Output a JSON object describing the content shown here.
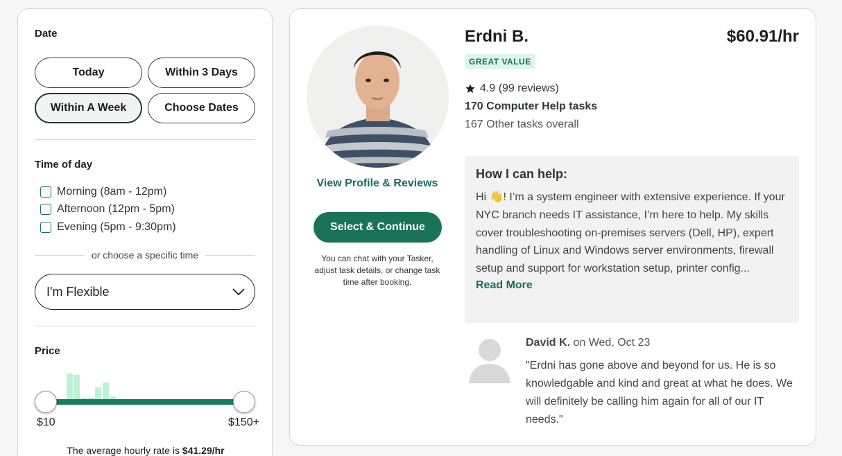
{
  "filters": {
    "date_title": "Date",
    "date_options": [
      "Today",
      "Within 3 Days",
      "Within A Week",
      "Choose Dates"
    ],
    "date_selected": "Within A Week",
    "time_title": "Time of day",
    "time_options": [
      "Morning (8am - 12pm)",
      "Afternoon (12pm - 5pm)",
      "Evening (5pm - 9:30pm)"
    ],
    "or_text": "or choose a specific time",
    "time_select_value": "I'm Flexible",
    "price_title": "Price",
    "price_min_label": "$10",
    "price_max_label": "$150+",
    "avg_prefix": "The average hourly rate is ",
    "avg_value": "$41.29/hr",
    "histogram": [
      0.85,
      0.82,
      0.15,
      0.15,
      0.45,
      0.6,
      0.2
    ],
    "accent_color": "#1a7a5e"
  },
  "tasker": {
    "name": "Erdni B.",
    "rate": "$60.91/hr",
    "badge": "GREAT VALUE",
    "rating": "4.9 (99 reviews)",
    "tasks_main": "170 Computer Help tasks",
    "tasks_other": "167 Other tasks overall",
    "view_profile": "View Profile & Reviews",
    "select_button": "Select & Continue",
    "chat_note": "You can chat with your Tasker, adjust task details, or change task time after booking.",
    "help_title": "How I can help:",
    "help_text": "Hi 👋! I’m a system engineer with extensive experience. If your NYC branch needs IT assistance, I’m here to help. My skills cover troubleshooting on-premises servers (Dell, HP), expert handling of Linux and Windows server environments, firewall setup and support for workstation setup, printer config...",
    "read_more": "Read More",
    "review": {
      "author": "David K.",
      "date": " on Wed, Oct 23",
      "text": "\"Erdni has gone above and beyond for us. He is so knowledgable and kind and great at what he does. We will definitely be calling him again for all of our IT needs.\""
    },
    "brand_color": "#1a7356"
  }
}
